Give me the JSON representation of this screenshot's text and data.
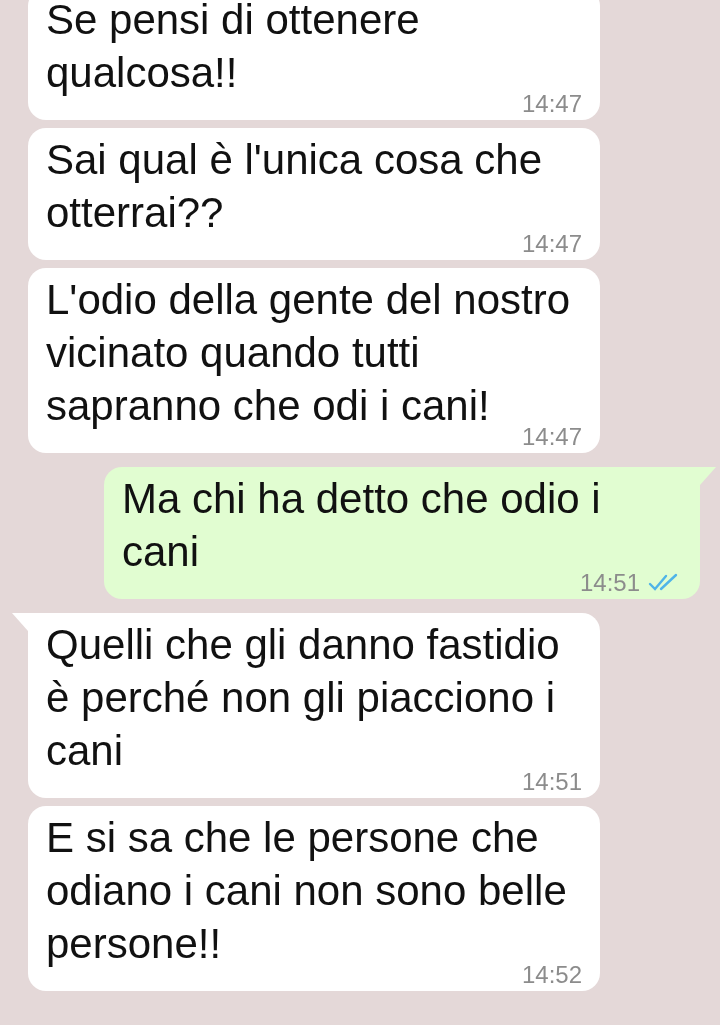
{
  "messages": [
    {
      "kind": "incoming",
      "tail": false,
      "text": "Se pensi di ottenere qualcosa!!",
      "time": "14:47"
    },
    {
      "kind": "incoming",
      "tail": false,
      "text": "Sai qual è l'unica cosa che otterrai??",
      "time": "14:47"
    },
    {
      "kind": "incoming",
      "tail": false,
      "text": "L'odio della gente del nostro vicinato quando tutti sapranno che odi i cani!",
      "time": "14:47"
    },
    {
      "kind": "outgoing",
      "tail": true,
      "text": "Ma chi ha detto che odio i cani",
      "time": "14:51",
      "read": true
    },
    {
      "kind": "incoming",
      "tail": true,
      "text": "Quelli che gli danno fastidio è perché non gli piacciono i cani",
      "time": "14:51"
    },
    {
      "kind": "incoming",
      "tail": false,
      "text": "E si sa che le persone che odiano i cani non sono belle persone!!",
      "time": "14:52"
    }
  ]
}
